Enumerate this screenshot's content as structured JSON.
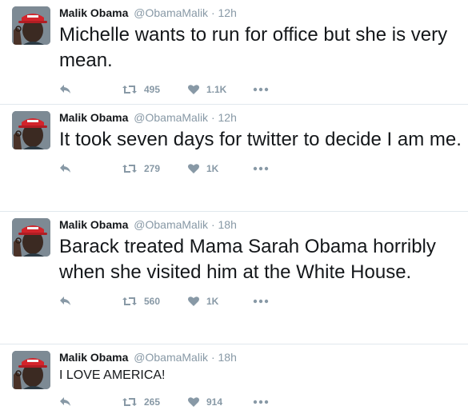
{
  "tweets": [
    {
      "name": "Malik Obama",
      "handle": "@ObamaMalik",
      "separator": "·",
      "time": "12h",
      "text": "Michelle wants to run for office but she is very mean.",
      "retweets": "495",
      "likes": "1.1K"
    },
    {
      "name": "Malik Obama",
      "handle": "@ObamaMalik",
      "separator": "·",
      "time": "12h",
      "text": "It took seven days for twitter to decide I am me.",
      "retweets": "279",
      "likes": "1K"
    },
    {
      "name": "Malik Obama",
      "handle": "@ObamaMalik",
      "separator": "·",
      "time": "18h",
      "text": "Barack treated Mama Sarah Obama horribly when she visited him at the White House.",
      "retweets": "560",
      "likes": "1K"
    },
    {
      "name": "Malik Obama",
      "handle": "@ObamaMalik",
      "separator": "·",
      "time": "18h",
      "text": "I LOVE AMERICA!",
      "retweets": "265",
      "likes": "914"
    }
  ],
  "icons": {
    "reply": "reply-arrow-icon",
    "retweet": "retweet-icon",
    "like": "heart-icon",
    "more": "more-dots-icon"
  },
  "colors": {
    "name": "#14171a",
    "meta": "#8899a6",
    "divider": "#e1e8ed",
    "hat": "#d3242b"
  }
}
